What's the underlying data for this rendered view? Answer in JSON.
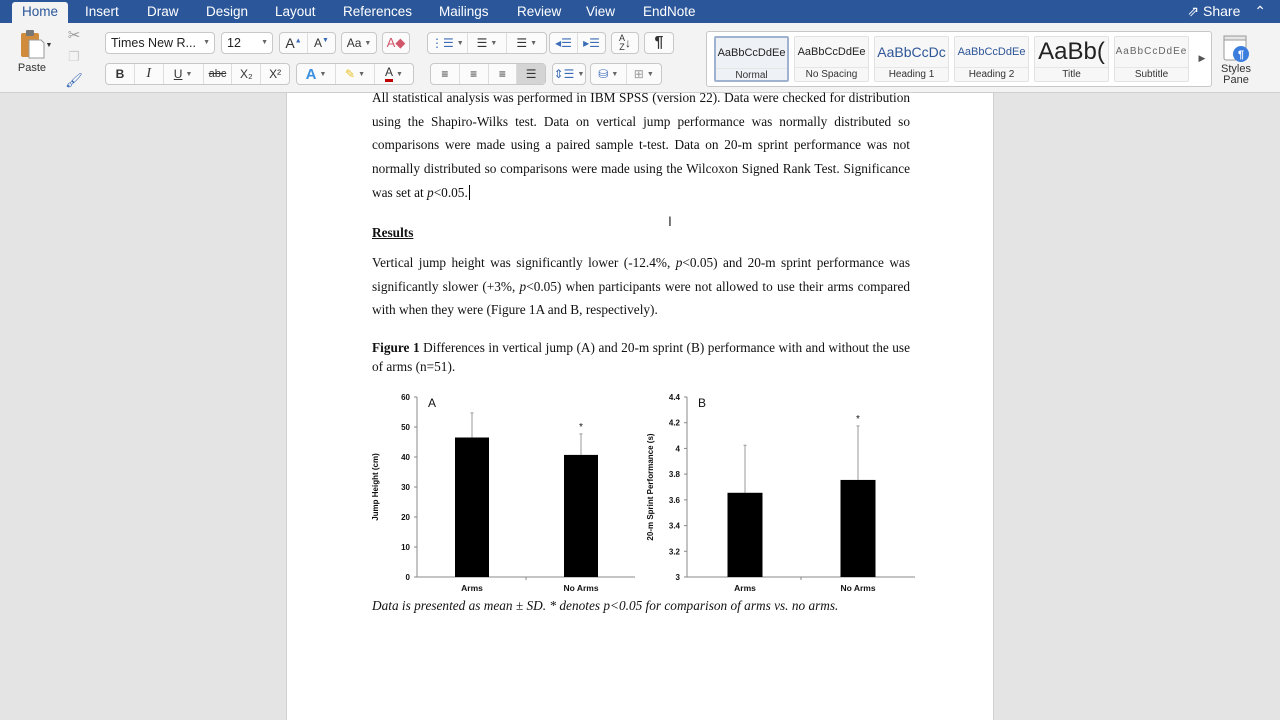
{
  "tabs": [
    {
      "label": "Home",
      "active": true
    },
    {
      "label": "Insert"
    },
    {
      "label": "Draw"
    },
    {
      "label": "Design"
    },
    {
      "label": "Layout"
    },
    {
      "label": "References"
    },
    {
      "label": "Mailings"
    },
    {
      "label": "Review"
    },
    {
      "label": "View"
    },
    {
      "label": "EndNote"
    }
  ],
  "share_label": "Share",
  "ribbon": {
    "paste_label": "Paste",
    "font_name": "Times New R...",
    "font_size": "12",
    "bold": "B",
    "italic": "I",
    "underline": "U",
    "strike": "abc",
    "subscript": "X₂",
    "superscript": "X²",
    "pilcrow": "¶",
    "styles": [
      {
        "preview": "AaBbCcDdEe",
        "name": "Normal",
        "selected": true
      },
      {
        "preview": "AaBbCcDdEe",
        "name": "No Spacing"
      },
      {
        "preview": "AaBbCcDc",
        "name": "Heading 1"
      },
      {
        "preview": "AaBbCcDdEe",
        "name": "Heading 2"
      },
      {
        "preview": "AaBb(",
        "name": "Title"
      },
      {
        "preview": "AaBbCcDdEe",
        "name": "Subtitle"
      }
    ],
    "styles_pane_label1": "Styles",
    "styles_pane_label2": "Pane"
  },
  "document": {
    "para1": "All statistical analysis was performed in IBM SPSS (version 22). Data were checked for distribution using the Shapiro-Wilks test. Data on vertical jump performance was normally distributed so comparisons were made using a paired sample t-test. Data on 20-m sprint performance was not normally distributed so comparisons were made using the Wilcoxon Signed Rank Test. Significance was set at ",
    "para1_p": "p",
    "para1_end": "<0.05. ",
    "results_heading": "Results",
    "results_a": "Vertical jump height was significantly lower (-12.4%, ",
    "results_p1": "p",
    "results_b": "<0.05) and 20-m sprint performance was significantly slower (+3%, ",
    "results_p2": "p",
    "results_c": "<0.05) when participants were not allowed to use their arms compared with when they were (Figure 1A and B, respectively).",
    "figure_label": "Figure 1",
    "figure_caption": " Differences in vertical jump (A) and 20-m sprint (B) performance with and without the use of arms (n=51).",
    "footnote": "Data is presented as mean ± SD. * denotes p<0.05 for comparison of arms vs. no arms."
  },
  "chart_data": [
    {
      "type": "bar",
      "panel": "A",
      "categories": [
        "Arms",
        "No Arms"
      ],
      "values": [
        46.5,
        40.7
      ],
      "error_sd": [
        8.2,
        7.0
      ],
      "significance": [
        "",
        "*"
      ],
      "ylabel": "Jump Height (cm)",
      "xlabel": "",
      "ylim": [
        0,
        60
      ],
      "yticks": [
        0,
        10,
        20,
        30,
        40,
        50,
        60
      ],
      "grid": false
    },
    {
      "type": "bar",
      "panel": "B",
      "categories": [
        "Arms",
        "No Arms"
      ],
      "values": [
        3.655,
        3.755
      ],
      "error_sd": [
        0.37,
        0.42
      ],
      "significance": [
        "",
        "*"
      ],
      "ylabel": "20-m Sprint Performance (s)",
      "xlabel": "",
      "ylim": [
        3,
        4.4
      ],
      "yticks": [
        "3",
        "3.2",
        "3.4",
        "3.6",
        "3.8",
        "4",
        "4.2",
        "4.4"
      ],
      "grid": false
    }
  ]
}
